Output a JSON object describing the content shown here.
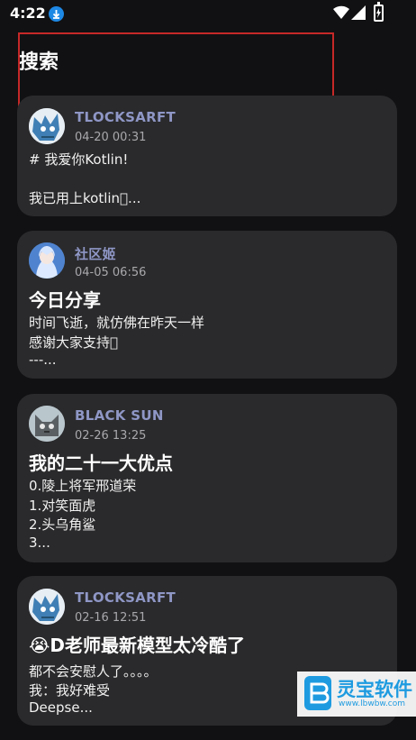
{
  "status_bar": {
    "time": "4:22"
  },
  "header": {
    "title": "搜索"
  },
  "posts": [
    {
      "author": "TLOCKSARFT",
      "date": "04-20 00:31",
      "title": "",
      "lines": [
        "# 我爱你Kotlin!",
        "",
        "我已用上kotlin􀀀..."
      ]
    },
    {
      "author": "社区姬",
      "date": "04-05 06:56",
      "title": "今日分享",
      "lines": [
        "时间飞逝，就仿佛在昨天一样",
        "感谢大家支持􀀀",
        "---..."
      ]
    },
    {
      "author": "BLACK SUN",
      "date": "02-26 13:25",
      "title": "我的二十一大优点",
      "lines": [
        "0.陵上将军邢道荣",
        "1.对笑面虎",
        "2.头乌角鲨",
        "3..."
      ]
    },
    {
      "author": "TLOCKSARFT",
      "date": "02-16 12:51",
      "title": "😭D老师最新模型太冷酷了",
      "lines": [
        "都不会安慰人了。。。。",
        "我：我好难受",
        "Deepse..."
      ]
    }
  ],
  "watermark": {
    "name": "灵宝软件",
    "url": "www.lbwbw.com"
  },
  "colors": {
    "background": "#111113",
    "card": "#2a2a2c",
    "author": "#8f97c6",
    "highlight": "#c62828"
  }
}
